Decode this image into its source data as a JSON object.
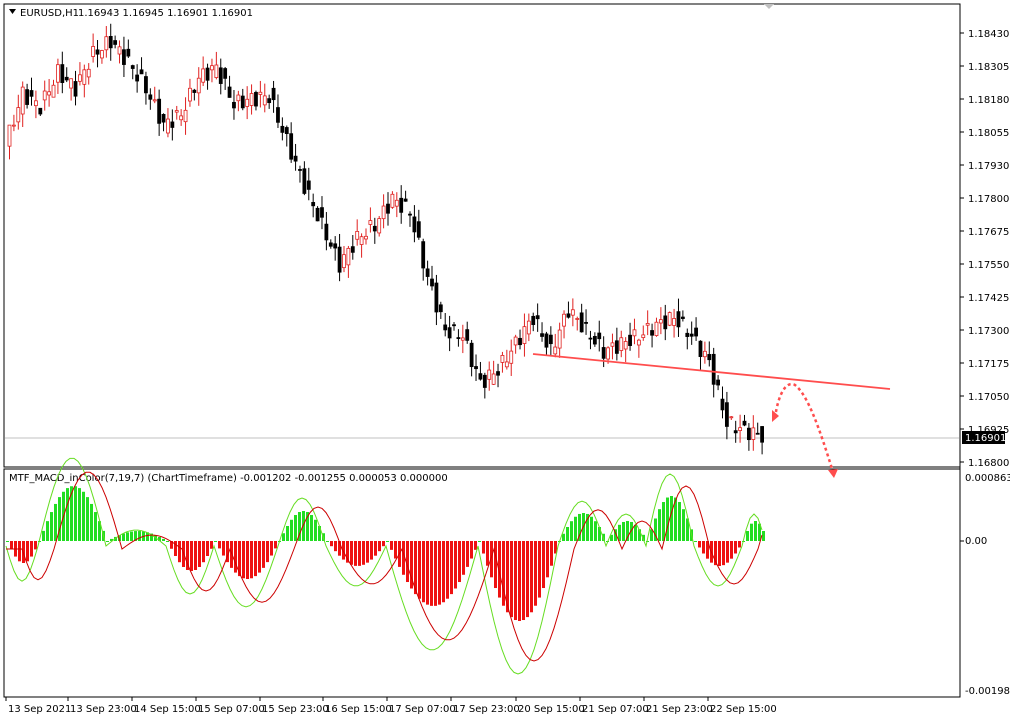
{
  "main_chart": {
    "symbol_label": "EURUSD,H1",
    "ohlc_label": "1.16943 1.16945 1.16901 1.16901",
    "price_levels": [
      "1.18430",
      "1.18305",
      "1.18180",
      "1.18055",
      "1.17930",
      "1.17800",
      "1.17675",
      "1.17550",
      "1.17425",
      "1.17300",
      "1.17175",
      "1.17050",
      "1.16925",
      "1.16800"
    ],
    "current_price": "1.16901",
    "trendline_color": "#ff4d4d",
    "arrow_color": "#ff4d4d",
    "bull_color": "#e0201f",
    "bear_color": "#000000"
  },
  "indicator": {
    "label": "MTF_MACD_inColor(7,19,7) (ChartTimeframe) -0.001202 -0.001255 0.000053 0.000000",
    "levels": [
      "0.000863",
      "0.00",
      "-0.001984"
    ],
    "positive_color": "#22dd22",
    "negative_color": "#ee1111",
    "main_line_color": "#66dd22",
    "signal_line_color": "#cc0000"
  },
  "time_axis": {
    "labels": [
      "13 Sep 2021",
      "13 Sep 23:00",
      "14 Sep 15:00",
      "15 Sep 07:00",
      "15 Sep 23:00",
      "16 Sep 15:00",
      "17 Sep 07:00",
      "17 Sep 23:00",
      "20 Sep 15:00",
      "21 Sep 07:00",
      "21 Sep 23:00",
      "22 Sep 15:00"
    ]
  },
  "chart_data": {
    "type": "candlestick",
    "x_range": [
      "13 Sep 2021",
      "22 Sep 15:00"
    ],
    "y_range": [
      1.168,
      1.1843
    ],
    "ohlc": [
      [
        1.18,
        1.1825,
        1.1793,
        1.182
      ],
      [
        1.182,
        1.1828,
        1.1812,
        1.1815
      ],
      [
        1.1815,
        1.183,
        1.181,
        1.1828
      ],
      [
        1.1828,
        1.1833,
        1.1818,
        1.1822
      ],
      [
        1.1822,
        1.1838,
        1.1815,
        1.1835
      ],
      [
        1.1835,
        1.1848,
        1.1828,
        1.184
      ],
      [
        1.184,
        1.1843,
        1.183,
        1.1832
      ],
      [
        1.1832,
        1.1836,
        1.1818,
        1.1822
      ],
      [
        1.1822,
        1.1825,
        1.1805,
        1.1808
      ],
      [
        1.1808,
        1.1815,
        1.18,
        1.1812
      ],
      [
        1.1812,
        1.183,
        1.1808,
        1.1826
      ],
      [
        1.1826,
        1.1833,
        1.182,
        1.183
      ],
      [
        1.183,
        1.1832,
        1.1812,
        1.1816
      ],
      [
        1.1816,
        1.182,
        1.1808,
        1.1818
      ],
      [
        1.1818,
        1.1822,
        1.181,
        1.1819
      ],
      [
        1.1819,
        1.182,
        1.18,
        1.1802
      ],
      [
        1.1802,
        1.1805,
        1.178,
        1.1785
      ],
      [
        1.1785,
        1.1788,
        1.1765,
        1.177
      ],
      [
        1.177,
        1.1775,
        1.1748,
        1.1755
      ],
      [
        1.1755,
        1.177,
        1.175,
        1.1765
      ],
      [
        1.1765,
        1.1778,
        1.176,
        1.177
      ],
      [
        1.177,
        1.1785,
        1.1765,
        1.178
      ],
      [
        1.178,
        1.179,
        1.177,
        1.1775
      ],
      [
        1.1775,
        1.1778,
        1.1745,
        1.175
      ],
      [
        1.175,
        1.1752,
        1.1725,
        1.173
      ],
      [
        1.173,
        1.1735,
        1.1722,
        1.1728
      ],
      [
        1.1728,
        1.173,
        1.1705,
        1.171
      ],
      [
        1.171,
        1.172,
        1.17,
        1.1715
      ],
      [
        1.1715,
        1.173,
        1.171,
        1.1725
      ],
      [
        1.1725,
        1.174,
        1.172,
        1.1735
      ],
      [
        1.1735,
        1.1738,
        1.1718,
        1.1722
      ],
      [
        1.1722,
        1.1742,
        1.172,
        1.1738
      ],
      [
        1.1738,
        1.1748,
        1.1725,
        1.173
      ],
      [
        1.173,
        1.1735,
        1.1718,
        1.1722
      ],
      [
        1.1722,
        1.1728,
        1.1715,
        1.1725
      ],
      [
        1.1725,
        1.1732,
        1.1718,
        1.1728
      ],
      [
        1.1728,
        1.174,
        1.1722,
        1.1732
      ],
      [
        1.1732,
        1.1745,
        1.1728,
        1.1735
      ],
      [
        1.1735,
        1.1738,
        1.1725,
        1.1728
      ],
      [
        1.1728,
        1.173,
        1.1712,
        1.1718
      ],
      [
        1.1718,
        1.172,
        1.169,
        1.1695
      ],
      [
        1.1695,
        1.1702,
        1.1688,
        1.1692
      ],
      [
        1.1692,
        1.1698,
        1.1686,
        1.169
      ]
    ]
  }
}
